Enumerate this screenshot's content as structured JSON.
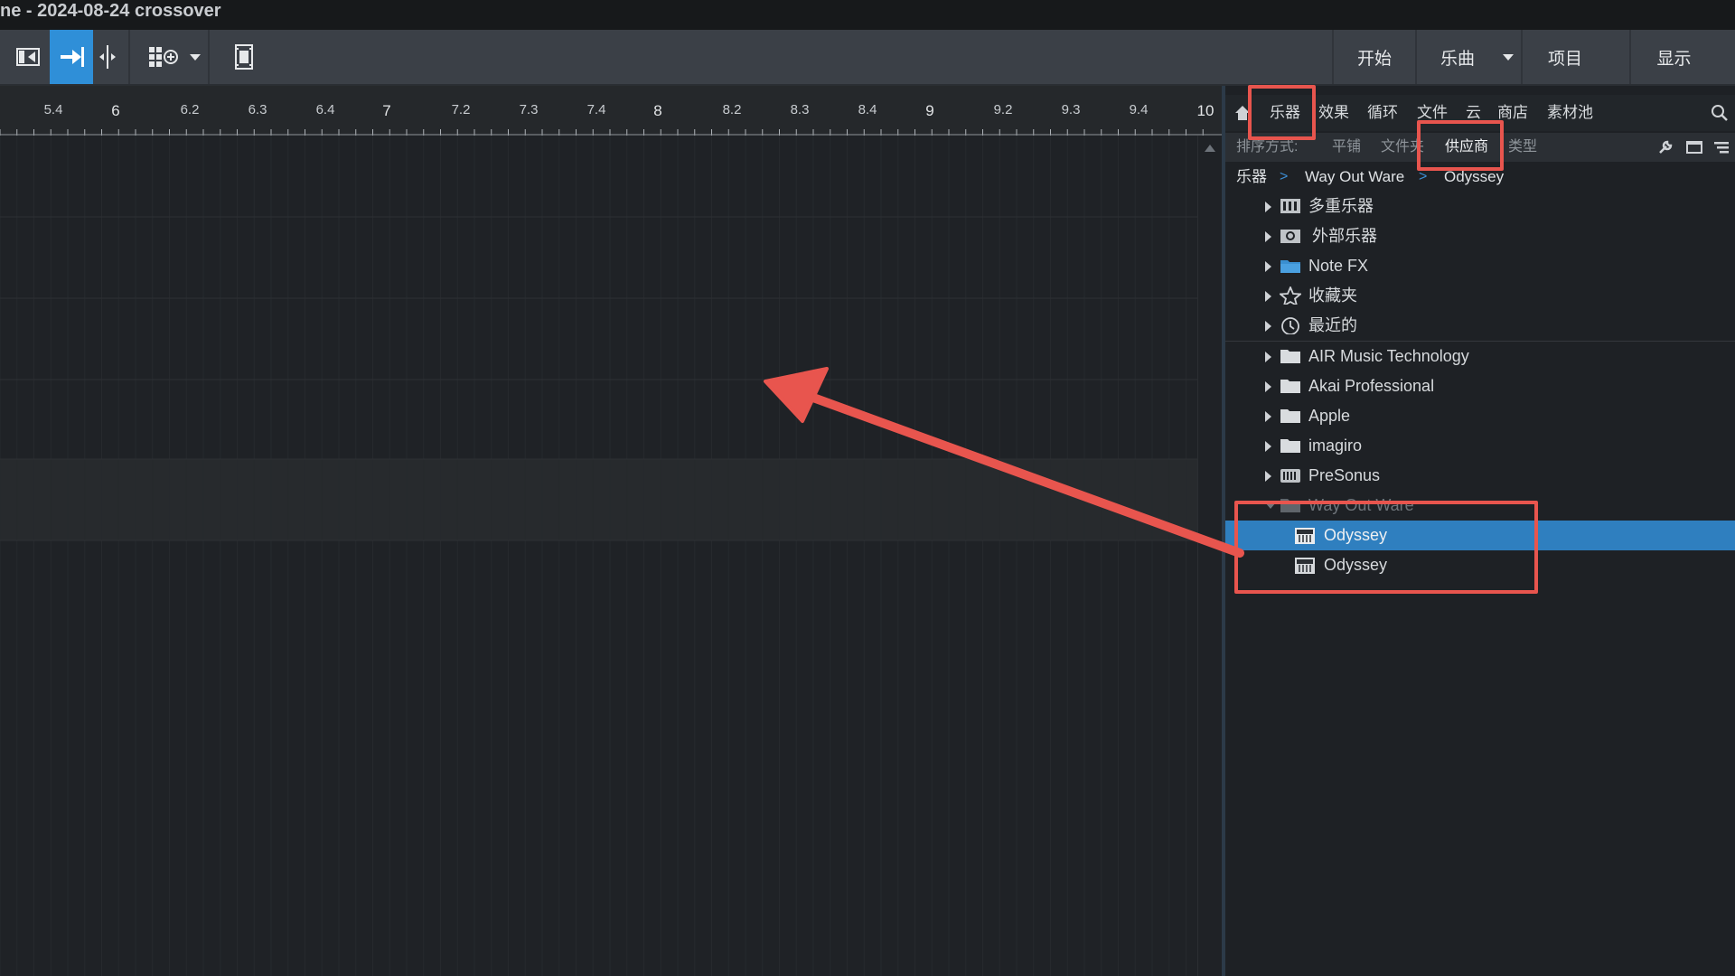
{
  "window": {
    "title": "ne - 2024-08-24 crossover"
  },
  "toolbar": {
    "nav": [
      "开始",
      "乐曲",
      "项目",
      "显示"
    ]
  },
  "ruler": {
    "labels": [
      {
        "t": "5.4",
        "major": false
      },
      {
        "t": "6",
        "major": true
      },
      {
        "t": "6.2",
        "major": false
      },
      {
        "t": "6.3",
        "major": false
      },
      {
        "t": "6.4",
        "major": false
      },
      {
        "t": "7",
        "major": true
      },
      {
        "t": "7.2",
        "major": false
      },
      {
        "t": "7.3",
        "major": false
      },
      {
        "t": "7.4",
        "major": false
      },
      {
        "t": "8",
        "major": true
      },
      {
        "t": "8.2",
        "major": false
      },
      {
        "t": "8.3",
        "major": false
      },
      {
        "t": "8.4",
        "major": false
      },
      {
        "t": "9",
        "major": true
      },
      {
        "t": "9.2",
        "major": false
      },
      {
        "t": "9.3",
        "major": false
      },
      {
        "t": "9.4",
        "major": false
      },
      {
        "t": "10",
        "major": true
      }
    ]
  },
  "browser": {
    "tabs": [
      "乐器",
      "效果",
      "循环",
      "文件",
      "云",
      "商店",
      "素材池"
    ],
    "sort_label": "排序方式:",
    "sort_options": [
      "平铺",
      "文件夹",
      "供应商",
      "类型"
    ],
    "sort_selected": "供应商",
    "breadcrumb": [
      "乐器",
      "Way Out Ware",
      "Odyssey"
    ],
    "breadcrumb_sep": ">",
    "system_items": [
      {
        "label": "多重乐器",
        "icon": "multi-instrument-icon"
      },
      {
        "label": "外部乐器",
        "icon": "external-instrument-icon"
      },
      {
        "label": "Note FX",
        "icon": "note-fx-folder-icon"
      },
      {
        "label": "收藏夹",
        "icon": "star-icon"
      },
      {
        "label": "最近的",
        "icon": "clock-icon"
      }
    ],
    "vendors": [
      {
        "label": "AIR Music Technology",
        "icon": "folder-icon"
      },
      {
        "label": "Akai Professional",
        "icon": "folder-icon"
      },
      {
        "label": "Apple",
        "icon": "folder-icon"
      },
      {
        "label": "imagiro",
        "icon": "folder-icon"
      },
      {
        "label": "PreSonus",
        "icon": "presonus-icon"
      },
      {
        "label": "Way Out Ware",
        "icon": "folder-icon"
      }
    ],
    "children": [
      {
        "label": "Odyssey",
        "selected": true
      },
      {
        "label": "Odyssey",
        "selected": false
      }
    ]
  },
  "colors": {
    "accent": "#2f8fd8",
    "selection": "#2f7fbf",
    "annotation": "#e8554e"
  }
}
